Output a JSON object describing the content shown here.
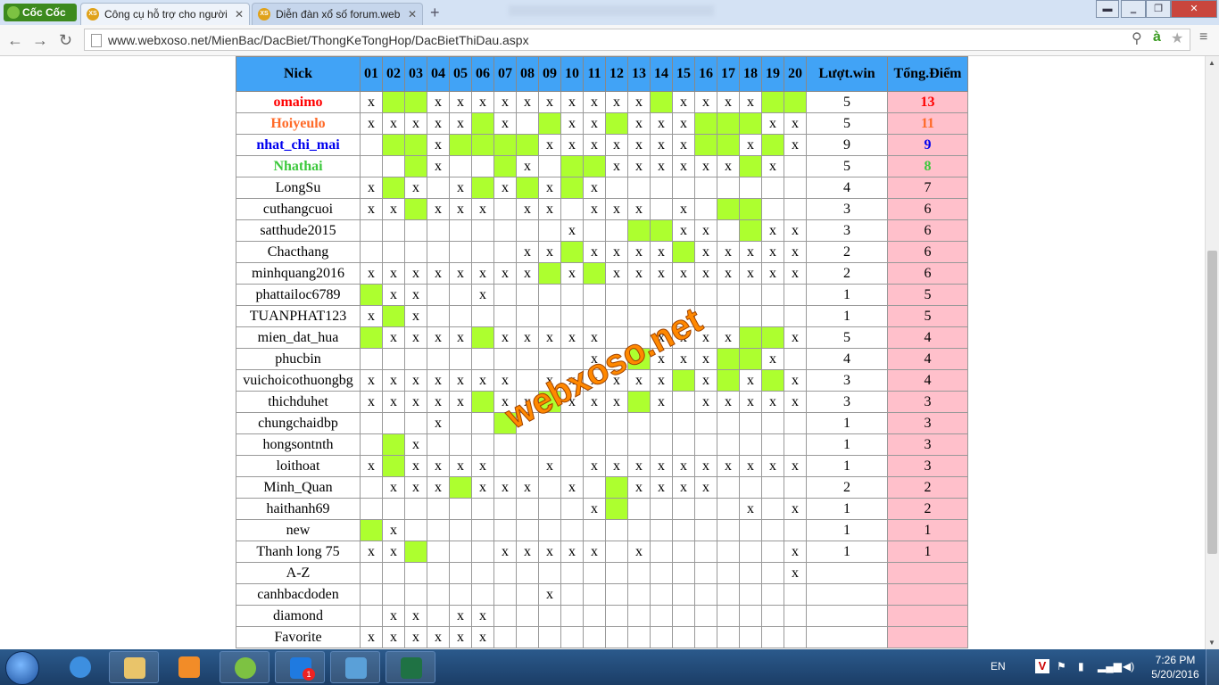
{
  "browser": {
    "logo_text": "Cốc Cốc",
    "tabs": [
      {
        "favicon": "XS",
        "title": "Công cụ hỗ trợ cho người"
      },
      {
        "favicon": "XS",
        "title": "Diễn đàn xổ số forum.web"
      }
    ],
    "url": "www.webxoso.net/MienBac/DacBiet/ThongKeTongHop/DacBietThiDau.aspx",
    "window_buttons": [
      "minimize",
      "maximize",
      "close"
    ]
  },
  "table": {
    "header_nick": "Nick",
    "day_headers": [
      "01",
      "02",
      "03",
      "04",
      "05",
      "06",
      "07",
      "08",
      "09",
      "10",
      "11",
      "12",
      "13",
      "14",
      "15",
      "16",
      "17",
      "18",
      "19",
      "20"
    ],
    "header_wins": "Lượt.win",
    "header_score": "Tổng.Điểm",
    "rows": [
      {
        "nick": "omaimo",
        "style": "red",
        "wins": "5",
        "score": "13",
        "cells": [
          "x",
          "g",
          "g",
          "x",
          "x",
          "x",
          "x",
          "x",
          "x",
          "x",
          "x",
          "x",
          "x",
          "g",
          "x",
          "x",
          "x",
          "x",
          "g",
          "g"
        ]
      },
      {
        "nick": "Hoiyeulo",
        "style": "orange",
        "wins": "5",
        "score": "11",
        "cells": [
          "x",
          "x",
          "x",
          "x",
          "x",
          "g",
          "x",
          "",
          "g",
          "x",
          "x",
          "g",
          "x",
          "x",
          "x",
          "g",
          "g",
          "g",
          "x",
          "x"
        ]
      },
      {
        "nick": "nhat_chi_mai",
        "style": "blue",
        "wins": "9",
        "score": "9",
        "cells": [
          "",
          "g",
          "g",
          "x",
          "g",
          "g",
          "g",
          "g",
          "x",
          "x",
          "x",
          "x",
          "x",
          "x",
          "x",
          "g",
          "g",
          "x",
          "g",
          "x"
        ]
      },
      {
        "nick": "Nhathai",
        "style": "green",
        "wins": "5",
        "score": "8",
        "cells": [
          "",
          "",
          "g",
          "x",
          "",
          "",
          "g",
          "x",
          "",
          "g",
          "g",
          "x",
          "x",
          "x",
          "x",
          "x",
          "x",
          "g",
          "x",
          ""
        ]
      },
      {
        "nick": "LongSu",
        "style": "",
        "wins": "4",
        "score": "7",
        "cells": [
          "x",
          "g",
          "x",
          "",
          "x",
          "g",
          "x",
          "g",
          "x",
          "g",
          "x",
          "",
          "",
          "",
          "",
          "",
          "",
          "",
          "",
          ""
        ]
      },
      {
        "nick": "cuthangcuoi",
        "style": "",
        "wins": "3",
        "score": "6",
        "cells": [
          "x",
          "x",
          "g",
          "x",
          "x",
          "x",
          "",
          "x",
          "x",
          "",
          "x",
          "x",
          "x",
          "",
          "x",
          "",
          "g",
          "g",
          "",
          ""
        ]
      },
      {
        "nick": "satthude2015",
        "style": "",
        "wins": "3",
        "score": "6",
        "cells": [
          "",
          "",
          "",
          "",
          "",
          "",
          "",
          "",
          "",
          "x",
          "",
          "",
          "g",
          "g",
          "x",
          "x",
          "",
          "g",
          "x",
          "x"
        ]
      },
      {
        "nick": "Chacthang",
        "style": "",
        "wins": "2",
        "score": "6",
        "cells": [
          "",
          "",
          "",
          "",
          "",
          "",
          "",
          "x",
          "x",
          "g",
          "x",
          "x",
          "x",
          "x",
          "g",
          "x",
          "x",
          "x",
          "x",
          "x"
        ]
      },
      {
        "nick": "minhquang2016",
        "style": "",
        "wins": "2",
        "score": "6",
        "cells": [
          "x",
          "x",
          "x",
          "x",
          "x",
          "x",
          "x",
          "x",
          "g",
          "x",
          "g",
          "x",
          "x",
          "x",
          "x",
          "x",
          "x",
          "x",
          "x",
          "x"
        ]
      },
      {
        "nick": "phattailoc6789",
        "style": "",
        "wins": "1",
        "score": "5",
        "cells": [
          "g",
          "x",
          "x",
          "",
          "",
          "x",
          "",
          "",
          "",
          "",
          "",
          "",
          "",
          "",
          "",
          "",
          "",
          "",
          "",
          ""
        ]
      },
      {
        "nick": "TUANPHAT123",
        "style": "",
        "wins": "1",
        "score": "5",
        "cells": [
          "x",
          "g",
          "x",
          "",
          "",
          "",
          "",
          "",
          "",
          "",
          "",
          "",
          "",
          "",
          "",
          "",
          "",
          "",
          "",
          ""
        ]
      },
      {
        "nick": "mien_dat_hua",
        "style": "",
        "wins": "5",
        "score": "4",
        "cells": [
          "g",
          "x",
          "x",
          "x",
          "x",
          "g",
          "x",
          "x",
          "x",
          "x",
          "x",
          "",
          "",
          "x",
          "x",
          "x",
          "x",
          "g",
          "g",
          "x"
        ]
      },
      {
        "nick": "phucbin",
        "style": "",
        "wins": "4",
        "score": "4",
        "cells": [
          "",
          "",
          "",
          "",
          "",
          "",
          "",
          "",
          "",
          "",
          "x",
          "",
          "g",
          "x",
          "x",
          "x",
          "g",
          "g",
          "x",
          ""
        ]
      },
      {
        "nick": "vuichoicothuongbg",
        "style": "",
        "wins": "3",
        "score": "4",
        "cells": [
          "x",
          "x",
          "x",
          "x",
          "x",
          "x",
          "x",
          "",
          "x",
          "x",
          "x",
          "x",
          "x",
          "x",
          "g",
          "x",
          "g",
          "x",
          "g",
          "x"
        ]
      },
      {
        "nick": "thichduhet",
        "style": "",
        "wins": "3",
        "score": "3",
        "cells": [
          "x",
          "x",
          "x",
          "x",
          "x",
          "g",
          "x",
          "x",
          "g",
          "x",
          "x",
          "x",
          "g",
          "x",
          "",
          "x",
          "x",
          "x",
          "x",
          "x"
        ]
      },
      {
        "nick": "chungchaidbp",
        "style": "",
        "wins": "1",
        "score": "3",
        "cells": [
          "",
          "",
          "",
          "x",
          "",
          "",
          "g",
          "",
          "",
          "",
          "",
          "",
          "",
          "",
          "",
          "",
          "",
          "",
          "",
          ""
        ]
      },
      {
        "nick": "hongsontnth",
        "style": "",
        "wins": "1",
        "score": "3",
        "cells": [
          "",
          "g",
          "x",
          "",
          "",
          "",
          "",
          "",
          "",
          "",
          "",
          "",
          "",
          "",
          "",
          "",
          "",
          "",
          "",
          ""
        ]
      },
      {
        "nick": "loithoat",
        "style": "",
        "wins": "1",
        "score": "3",
        "cells": [
          "x",
          "g",
          "x",
          "x",
          "x",
          "x",
          "",
          "",
          "x",
          "",
          "x",
          "x",
          "x",
          "x",
          "x",
          "x",
          "x",
          "x",
          "x",
          "x"
        ]
      },
      {
        "nick": "Minh_Quan",
        "style": "",
        "wins": "2",
        "score": "2",
        "cells": [
          "",
          "x",
          "x",
          "x",
          "g",
          "x",
          "x",
          "x",
          "",
          "x",
          "",
          "g",
          "x",
          "x",
          "x",
          "x",
          "",
          "",
          "",
          ""
        ]
      },
      {
        "nick": "haithanh69",
        "style": "",
        "wins": "1",
        "score": "2",
        "cells": [
          "",
          "",
          "",
          "",
          "",
          "",
          "",
          "",
          "",
          "",
          "x",
          "g",
          "",
          "",
          "",
          "",
          "",
          "x",
          "",
          "x"
        ]
      },
      {
        "nick": "new",
        "style": "",
        "wins": "1",
        "score": "1",
        "cells": [
          "g",
          "x",
          "",
          "",
          "",
          "",
          "",
          "",
          "",
          "",
          "",
          "",
          "",
          "",
          "",
          "",
          "",
          "",
          "",
          ""
        ]
      },
      {
        "nick": "Thanh long 75",
        "style": "",
        "wins": "1",
        "score": "1",
        "cells": [
          "x",
          "x",
          "g",
          "",
          "",
          "",
          "x",
          "x",
          "x",
          "x",
          "x",
          "",
          "x",
          "",
          "",
          "",
          "",
          "",
          "",
          "x"
        ]
      },
      {
        "nick": "A-Z",
        "style": "",
        "wins": "",
        "score": "",
        "cells": [
          "",
          "",
          "",
          "",
          "",
          "",
          "",
          "",
          "",
          "",
          "",
          "",
          "",
          "",
          "",
          "",
          "",
          "",
          "",
          "x"
        ]
      },
      {
        "nick": "canhbacdoden",
        "style": "",
        "wins": "",
        "score": "",
        "cells": [
          "",
          "",
          "",
          "",
          "",
          "",
          "",
          "",
          "x",
          "",
          "",
          "",
          "",
          "",
          "",
          "",
          "",
          "",
          "",
          ""
        ]
      },
      {
        "nick": "diamond",
        "style": "",
        "wins": "",
        "score": "",
        "cells": [
          "",
          "x",
          "x",
          "",
          "x",
          "x",
          "",
          "",
          "",
          "",
          "",
          "",
          "",
          "",
          "",
          "",
          "",
          "",
          "",
          ""
        ]
      },
      {
        "nick": "Favorite",
        "style": "",
        "wins": "",
        "score": "",
        "cells": [
          "x",
          "x",
          "x",
          "x",
          "x",
          "x",
          "",
          "",
          "",
          "",
          "",
          "",
          "",
          "",
          "",
          "",
          "",
          "",
          "",
          ""
        ]
      }
    ]
  },
  "watermark": "webxoso.net",
  "taskbar": {
    "apps": [
      "explorer",
      "ie",
      "folder",
      "media-player",
      "coccoc",
      "zalo",
      "photo-viewer",
      "excel"
    ],
    "zalo_badge": "1",
    "language": "EN",
    "time": "7:26 PM",
    "date": "5/20/2016"
  },
  "colors": {
    "header_blue": "#41a3f6",
    "green_cell": "#adff2f",
    "score_pink": "#ffc0cb"
  }
}
